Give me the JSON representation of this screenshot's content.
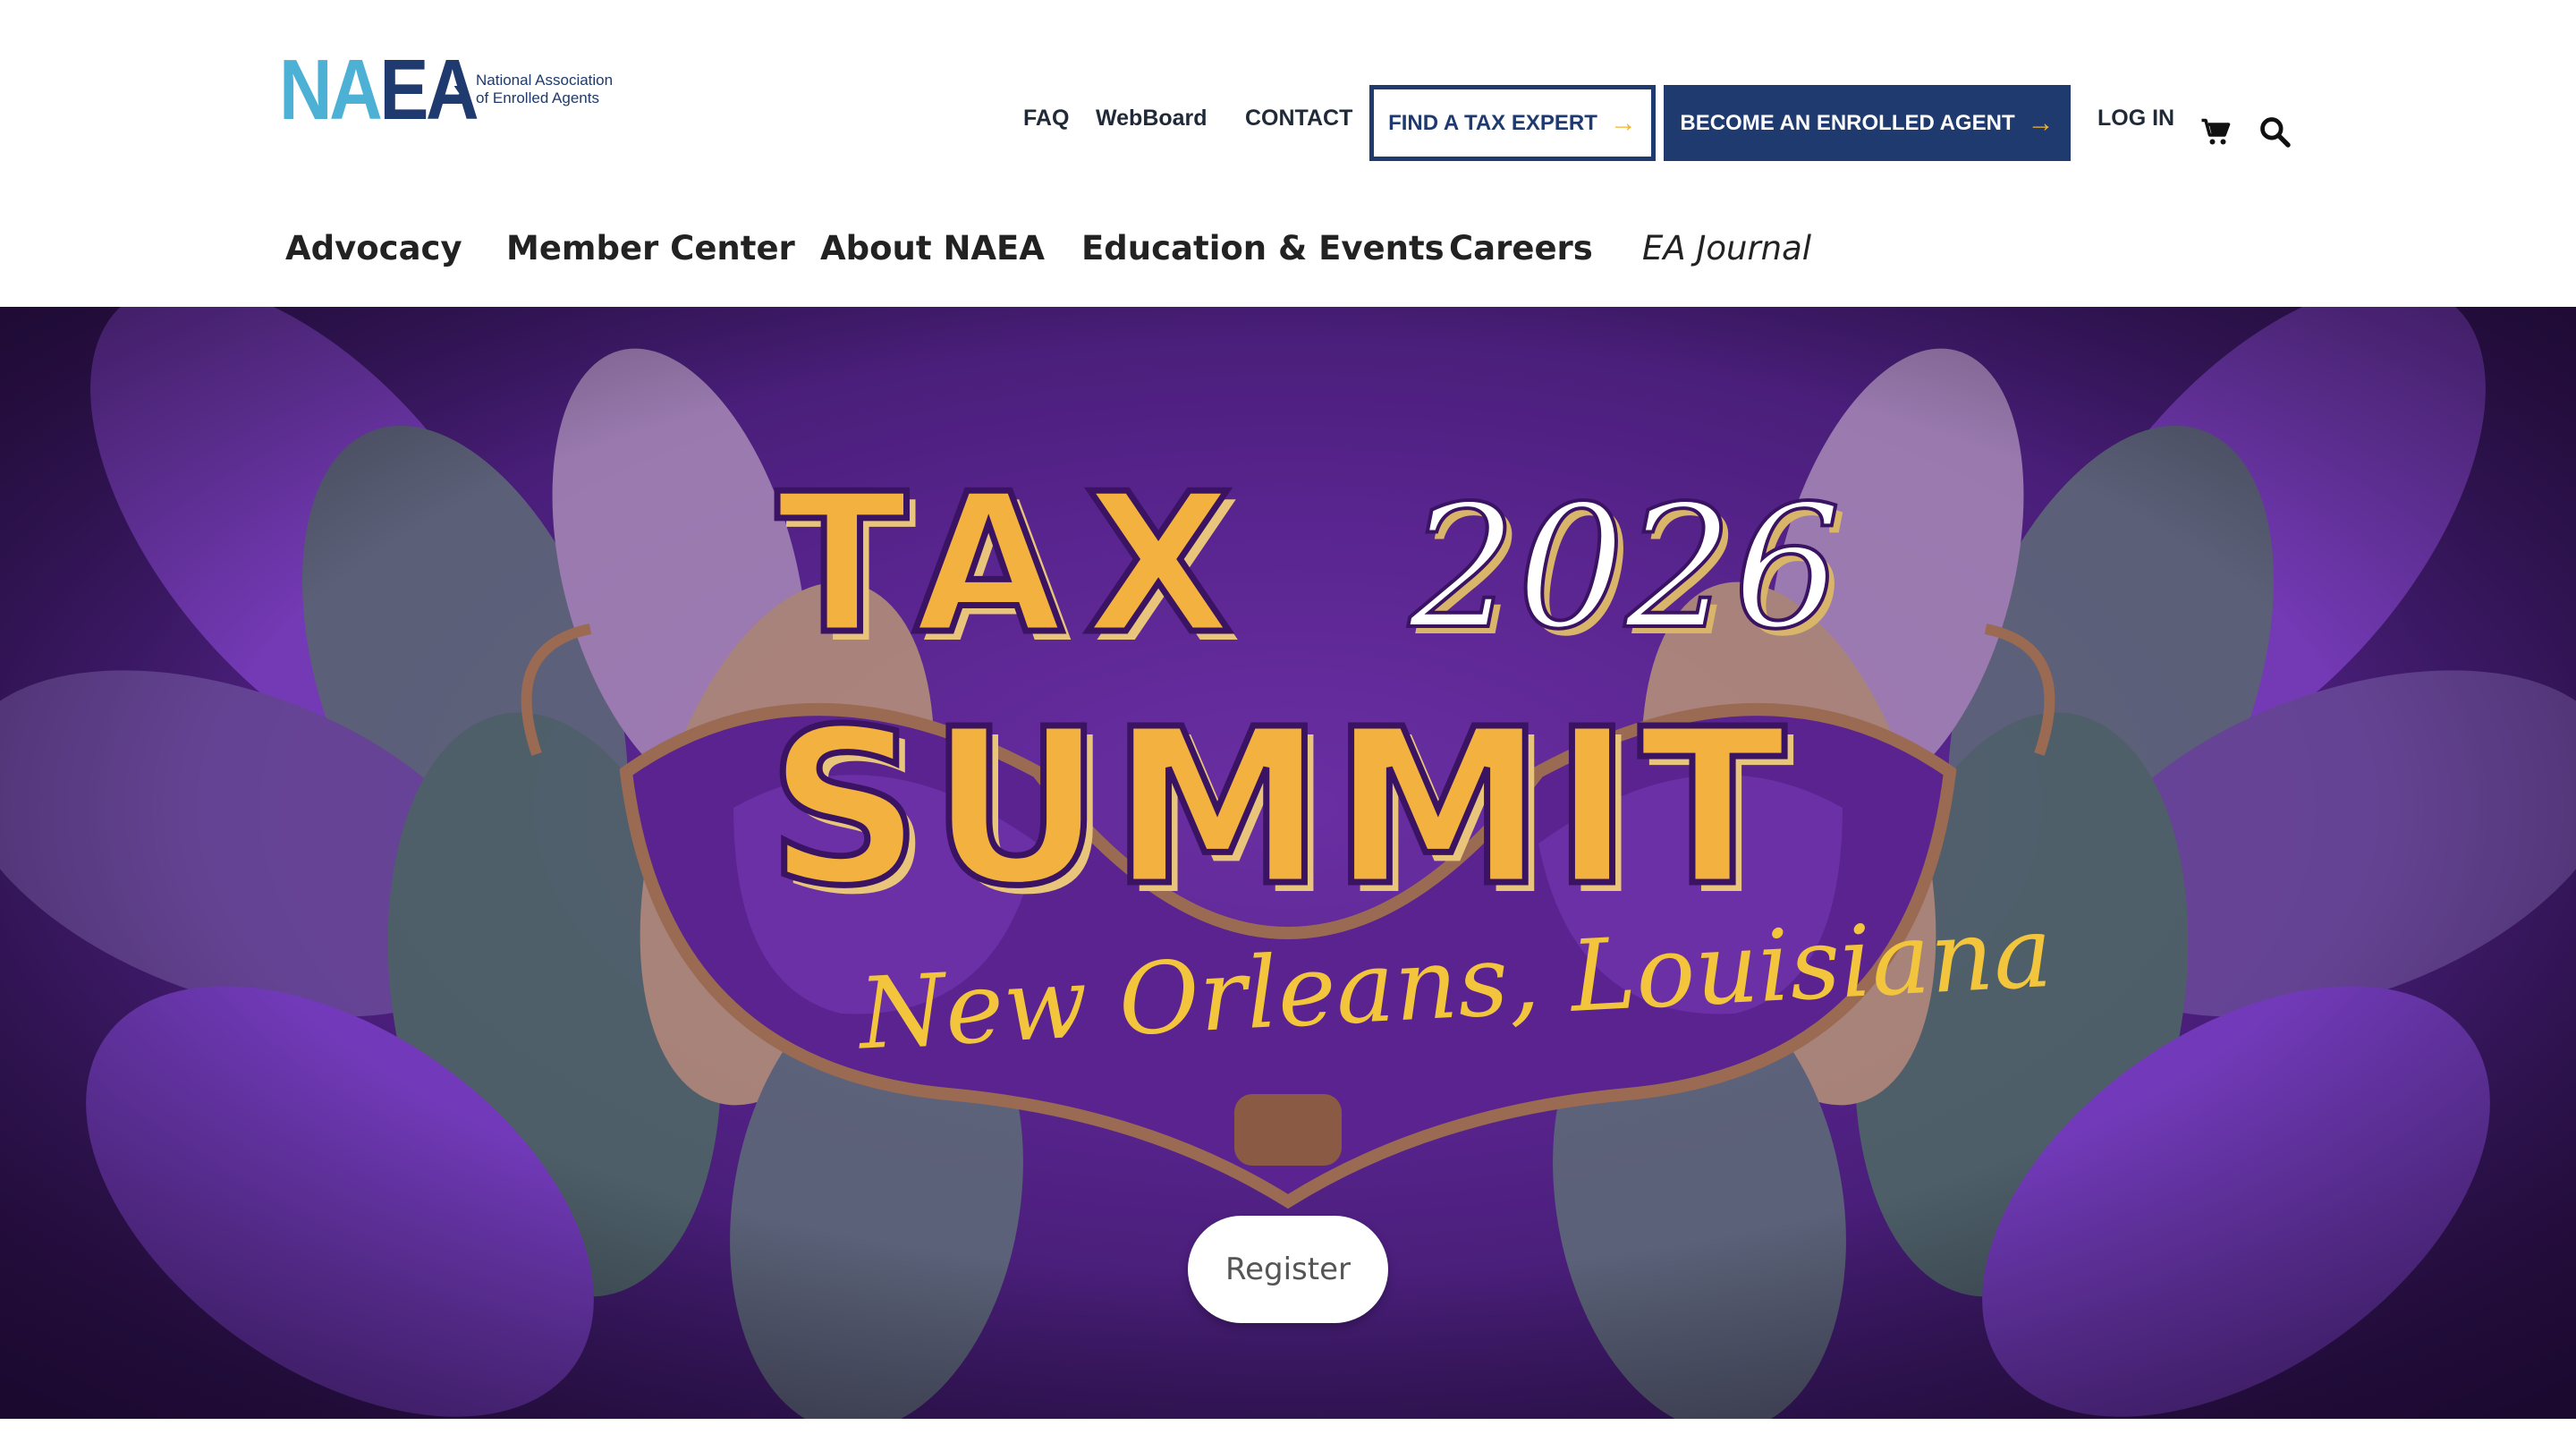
{
  "header": {
    "logo": {
      "mark_left": "NA",
      "mark_right": "EA",
      "subtitle_line1": "National Association",
      "subtitle_line2": "of Enrolled Agents"
    },
    "utility_links": {
      "faq": "FAQ",
      "webboard": "WebBoard",
      "contact": "CONTACT",
      "login": "LOG IN"
    },
    "buttons": {
      "find_expert": "FIND A TAX EXPERT",
      "become_agent": "BECOME AN ENROLLED AGENT"
    },
    "icons": {
      "cart": "cart-icon",
      "search": "search-icon",
      "arrow": "arrow-right-icon"
    },
    "colors": {
      "navy": "#1e3a6e",
      "light_blue": "#4db1d6",
      "gold": "#f0b429"
    }
  },
  "main_nav": {
    "items": [
      {
        "label": "Advocacy"
      },
      {
        "label": "Member Center"
      },
      {
        "label": "About NAEA"
      },
      {
        "label": "Education & Events"
      },
      {
        "label": "Careers"
      },
      {
        "label": "EA Journal"
      }
    ]
  },
  "hero": {
    "title_word1": "TAX",
    "title_year": "2026",
    "title_word2": "SUMMIT",
    "location": "New Orleans, Louisiana",
    "register_label": "Register",
    "colors": {
      "purple": "#58248e",
      "gold": "#f3b13f"
    }
  }
}
